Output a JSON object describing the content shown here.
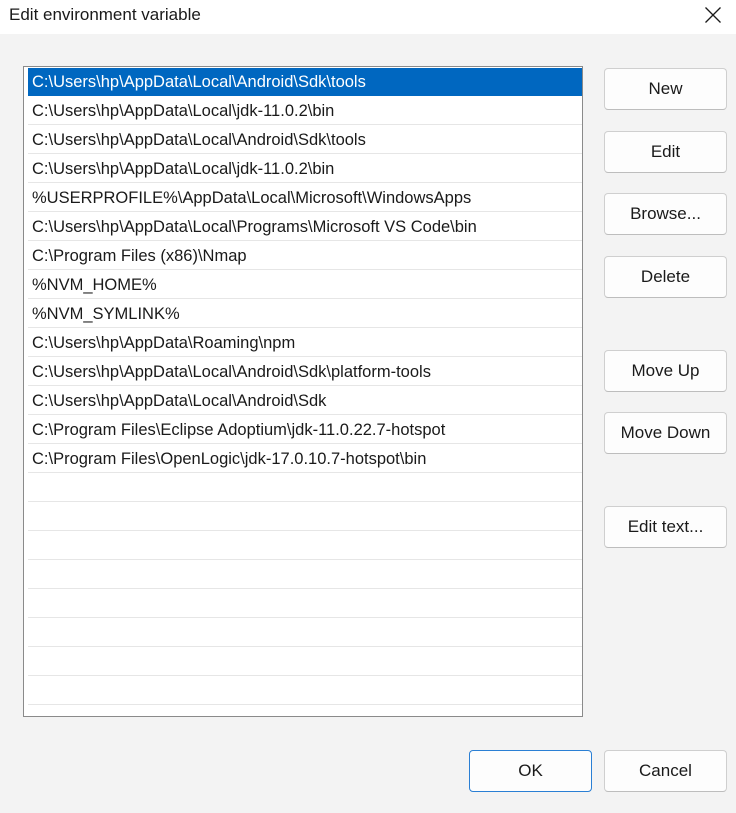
{
  "window": {
    "title": "Edit environment variable"
  },
  "list": {
    "items": [
      "C:\\Users\\hp\\AppData\\Local\\Android\\Sdk\\tools",
      "C:\\Users\\hp\\AppData\\Local\\jdk-11.0.2\\bin",
      "C:\\Users\\hp\\AppData\\Local\\Android\\Sdk\\tools",
      "C:\\Users\\hp\\AppData\\Local\\jdk-11.0.2\\bin",
      "%USERPROFILE%\\AppData\\Local\\Microsoft\\WindowsApps",
      "C:\\Users\\hp\\AppData\\Local\\Programs\\Microsoft VS Code\\bin",
      "C:\\Program Files (x86)\\Nmap",
      "%NVM_HOME%",
      "%NVM_SYMLINK%",
      "C:\\Users\\hp\\AppData\\Roaming\\npm",
      "C:\\Users\\hp\\AppData\\Local\\Android\\Sdk\\platform-tools",
      "C:\\Users\\hp\\AppData\\Local\\Android\\Sdk",
      "C:\\Program Files\\Eclipse Adoptium\\jdk-11.0.22.7-hotspot",
      "C:\\Program Files\\OpenLogic\\jdk-17.0.10.7-hotspot\\bin"
    ],
    "selected_index": 0,
    "selection_color": "#0067c0"
  },
  "buttons": {
    "new": "New",
    "edit": "Edit",
    "browse": "Browse...",
    "delete": "Delete",
    "move_up": "Move Up",
    "move_down": "Move Down",
    "edit_text": "Edit text...",
    "ok": "OK",
    "cancel": "Cancel"
  },
  "icons": {
    "close": "close-icon"
  }
}
